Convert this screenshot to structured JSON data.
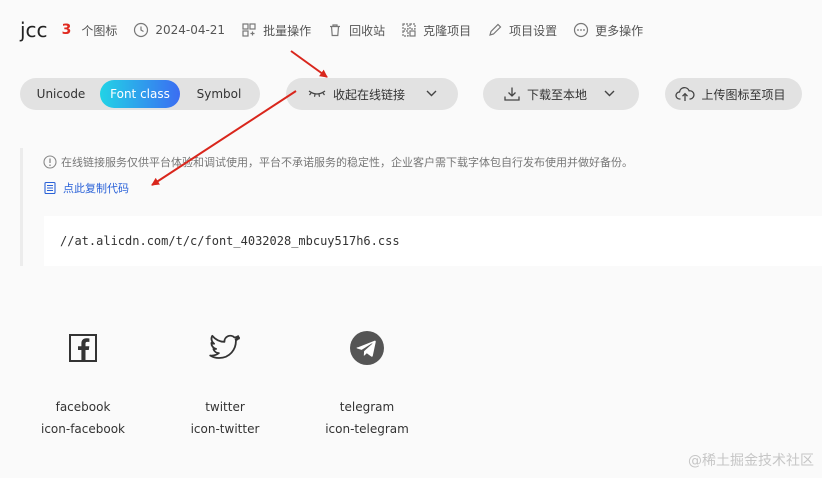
{
  "header": {
    "project_name": "jcc",
    "icon_count": "3",
    "icon_count_label": "个图标",
    "date": "2024-04-21",
    "batch_ops": "批量操作",
    "recycle_bin": "回收站",
    "clone_project": "克隆项目",
    "project_settings": "项目设置",
    "more_ops": "更多操作"
  },
  "toolbar": {
    "mode_tabs": [
      {
        "label": "Unicode",
        "active": false
      },
      {
        "label": "Font class",
        "active": true
      },
      {
        "label": "Symbol",
        "active": false
      }
    ],
    "collapse_link_label": "收起在线链接",
    "download_label": "下载至本地",
    "upload_label": "上传图标至项目"
  },
  "link_panel": {
    "notice": "在线链接服务仅供平台体验和调试使用，平台不承诺服务的稳定性，企业客户需下载字体包自行发布使用并做好备份。",
    "copy_code_label": "点此复制代码",
    "css_url": "//at.alicdn.com/t/c/font_4032028_mbcuy517h6.css"
  },
  "icons": [
    {
      "name": "facebook",
      "class_name": "icon-facebook",
      "icon": "facebook-icon"
    },
    {
      "name": "twitter",
      "class_name": "icon-twitter",
      "icon": "twitter-icon"
    },
    {
      "name": "telegram",
      "class_name": "icon-telegram",
      "icon": "telegram-icon"
    }
  ],
  "watermark": "@稀土掘金技术社区",
  "colors": {
    "accent_red": "#e0291f",
    "link_blue": "#2a62d8",
    "active_gradient_start": "#22d3e6",
    "active_gradient_end": "#3b6df2",
    "pill_bg": "#e2e2e2",
    "arrow_red": "#d9261c"
  }
}
